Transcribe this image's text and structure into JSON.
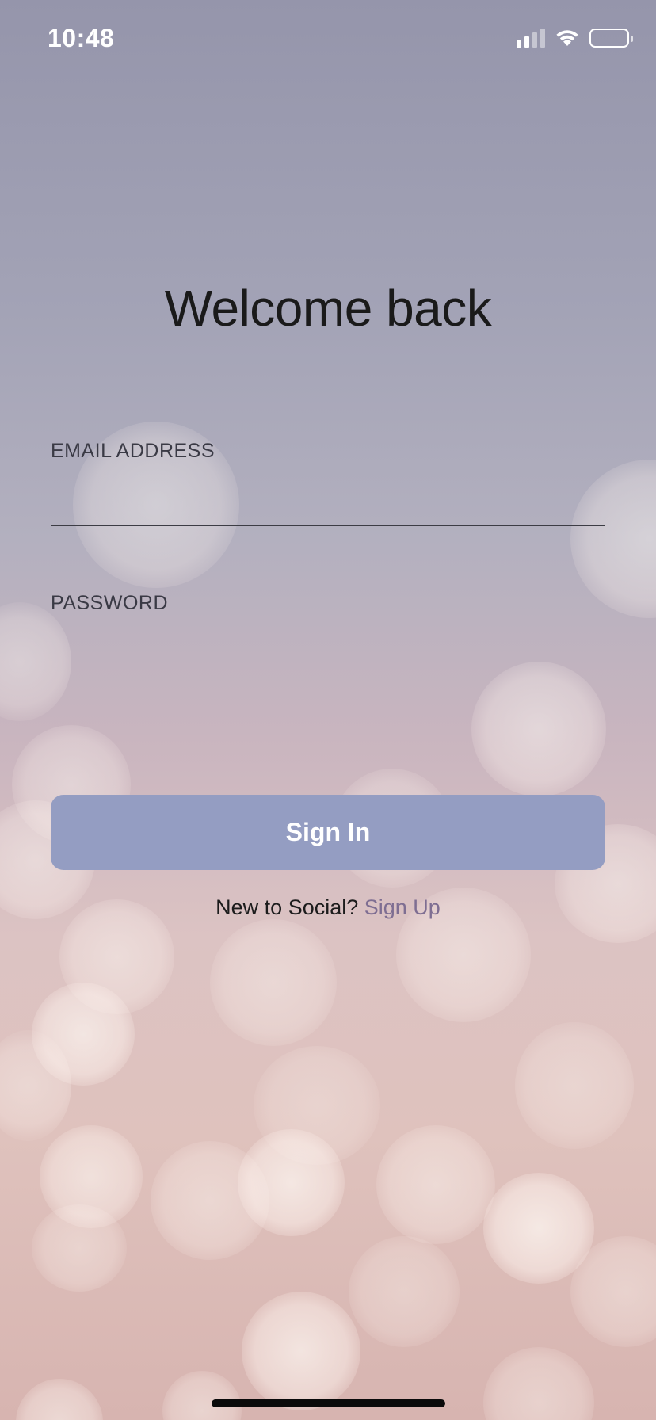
{
  "status_bar": {
    "time": "10:48",
    "icons": [
      "cellular-signal-icon",
      "wifi-icon",
      "battery-icon"
    ]
  },
  "title": "Welcome back",
  "form": {
    "email": {
      "label": "EMAIL ADDRESS",
      "value": "",
      "placeholder": ""
    },
    "password": {
      "label": "PASSWORD",
      "value": "",
      "placeholder": ""
    },
    "signin_label": "Sign In"
  },
  "signup": {
    "prompt": "New to Social?",
    "link_label": "Sign Up"
  },
  "colors": {
    "button_bg": "#949dc2",
    "link": "#7e6e92",
    "title": "#1a1a1a"
  }
}
